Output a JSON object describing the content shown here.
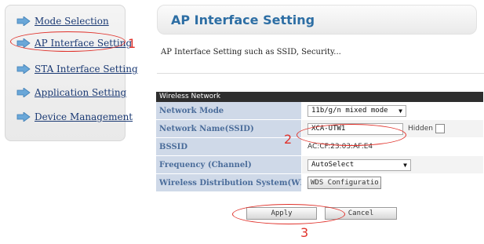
{
  "sidebar": {
    "items": [
      {
        "label": "Mode Selection"
      },
      {
        "label": "AP Interface Setting"
      },
      {
        "label": "STA Interface Setting"
      },
      {
        "label": "Application Setting"
      },
      {
        "label": "Device Management"
      }
    ]
  },
  "header": {
    "title": "AP Interface Setting",
    "subtitle": "AP Interface Setting such as SSID, Security..."
  },
  "wireless": {
    "section_title": "Wireless Network",
    "rows": {
      "mode": {
        "label": "Network Mode",
        "value": "11b/g/n mixed mode"
      },
      "ssid": {
        "label": "Network Name(SSID)",
        "value": "XCA-UTW1",
        "hidden_label": "Hidden"
      },
      "bssid": {
        "label": "BSSID",
        "value": "AC:CF:23:03:AF:E4"
      },
      "freq": {
        "label": "Frequency (Channel)",
        "value": "AutoSelect"
      },
      "wds": {
        "label": "Wireless Distribution System(WDS)",
        "button": "WDS Configuratio"
      }
    }
  },
  "actions": {
    "apply": "Apply",
    "cancel": "Cancel"
  },
  "annotations": {
    "n1": "1",
    "n2": "2",
    "n3": "3"
  },
  "colors": {
    "accent": "#2d6ea4",
    "annotation": "#e0312a",
    "row_label_bg": "#cfd9e8",
    "header_bar": "#2e2e2e"
  },
  "icons": {
    "nav": "arrow-right-icon"
  }
}
